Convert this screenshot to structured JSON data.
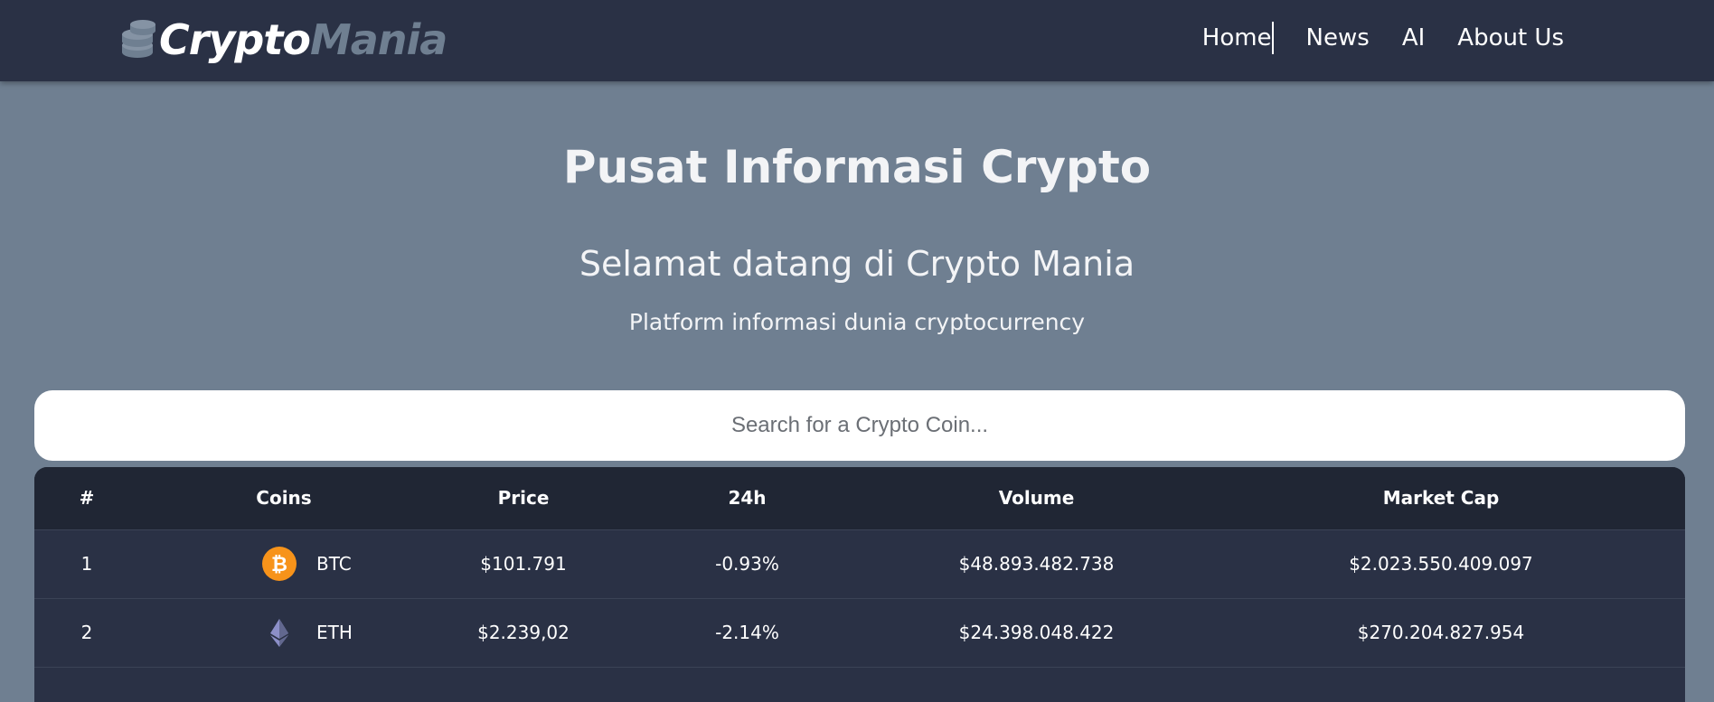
{
  "brand": {
    "part1": "Crypto",
    "part2": "Mania",
    "icon": "coins-stack-icon"
  },
  "nav": {
    "items": [
      "Home",
      "News",
      "AI",
      "About Us"
    ]
  },
  "hero": {
    "title": "Pusat Informasi Crypto",
    "subtitle": "Selamat datang di Crypto Mania",
    "tagline": "Platform informasi dunia cryptocurrency"
  },
  "search": {
    "placeholder": "Search for a Crypto Coin...",
    "value": ""
  },
  "table": {
    "headers": [
      "#",
      "Coins",
      "Price",
      "24h",
      "Volume",
      "Market Cap"
    ],
    "rows": [
      {
        "rank": "1",
        "symbol": "BTC",
        "icon": "bitcoin-icon",
        "price": "$101.791",
        "change": "-0.93%",
        "volume": "$48.893.482.738",
        "market_cap": "$2.023.550.409.097"
      },
      {
        "rank": "2",
        "symbol": "ETH",
        "icon": "ethereum-icon",
        "price": "$2.239,02",
        "change": "-2.14%",
        "volume": "$24.398.048.422",
        "market_cap": "$270.204.827.954"
      }
    ]
  },
  "colors": {
    "navbar": "#2a3145",
    "page_bg": "#6f7f91",
    "table_header": "#202634",
    "bitcoin": "#f7931a"
  }
}
